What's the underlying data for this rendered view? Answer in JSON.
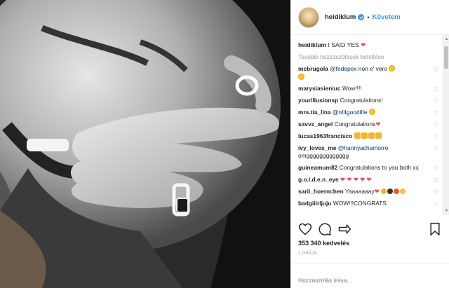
{
  "post": {
    "image_alt": "Black and white close-up of a couple; a hand with an engagement ring covers a smiling man's mouth",
    "username": "heidiklum",
    "follow_label": "Követem",
    "separator": "•",
    "caption_user": "heidiklum",
    "caption_text": "I SAID YES",
    "load_more": "További hozzászólások betöltése",
    "likes": "353 340 kedvelés",
    "time": "2 ÓRÁJA",
    "comment_placeholder": "Hozzászólás írása..."
  },
  "comments": [
    {
      "user": "mcbrugola",
      "mention": "@fedepex",
      "text": " non e' vero "
    },
    {
      "user": "marysiasieniuc",
      "text": "Wow!!!!"
    },
    {
      "user": "yourillusionsp",
      "text": "Congratulations!"
    },
    {
      "user": "mrs.tia_lina",
      "mention": "@nf4goodlife",
      "text": " "
    },
    {
      "user": "savvz_angel",
      "text": "Congratulations"
    },
    {
      "user": "lucas1963francisco",
      "text": ""
    },
    {
      "user": "ivy_loves_me",
      "mention": "@hannyachamorro",
      "text": " omggggggggggggg"
    },
    {
      "user": "guineamum82",
      "text": "Congratulations to you both xx"
    },
    {
      "user": "g.o.l.d.e.n_eye",
      "text": " "
    },
    {
      "user": "sarii_hoernchen",
      "text": "Yaaaaaaay"
    },
    {
      "user": "badgiiirljuju",
      "text": "WOW!!!CONGRATS"
    }
  ],
  "colors": {
    "link": "#3897f0",
    "heart": "#ed4956",
    "muted": "#999999",
    "border": "#efefef"
  },
  "icons": [
    "verified-badge-icon",
    "heart-icon",
    "comment-icon",
    "share-icon",
    "bookmark-icon"
  ]
}
